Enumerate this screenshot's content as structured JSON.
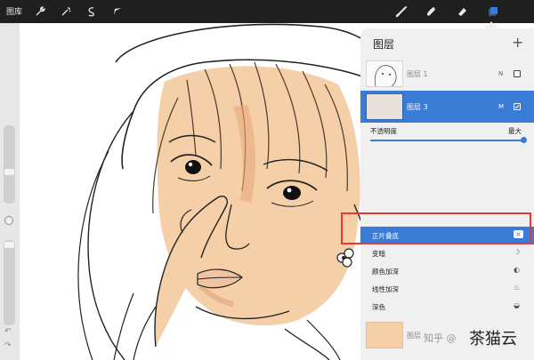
{
  "toolbar": {
    "gallery_label": "图库",
    "left_tools": [
      "wrench-icon",
      "magic-wand-icon",
      "selection-icon",
      "transform-arrow-icon"
    ],
    "right_tools": [
      "brush-icon",
      "smudge-icon",
      "eraser-icon",
      "layers-icon"
    ],
    "accent_color": "#3a7bd5"
  },
  "layers_panel": {
    "title": "图层",
    "add_symbol": "+",
    "layers": [
      {
        "name": "图层 1",
        "mode": "N",
        "selected": false
      },
      {
        "name": "图层 3",
        "mode": "M",
        "selected": true
      }
    ],
    "opacity": {
      "label": "不透明度",
      "max_label": "最大",
      "value": 1.0
    },
    "blend_modes": [
      {
        "label": "正片叠底",
        "glyph": "×",
        "selected": true
      },
      {
        "label": "变暗",
        "glyph": "☽",
        "selected": false
      },
      {
        "label": "颜色加深",
        "glyph": "◐",
        "selected": false
      },
      {
        "label": "线性加深",
        "glyph": "♨",
        "selected": false
      },
      {
        "label": "深色",
        "glyph": "◒",
        "selected": false
      }
    ],
    "bottom_layer_name": "图层"
  },
  "watermarks": {
    "zhihu": "知乎 @",
    "brand": "茶猫云"
  },
  "colors": {
    "skin": "#f5cfa8",
    "blush": "#eab48c",
    "highlight_red": "#e53935",
    "selected_row": "#3a7bd5"
  }
}
